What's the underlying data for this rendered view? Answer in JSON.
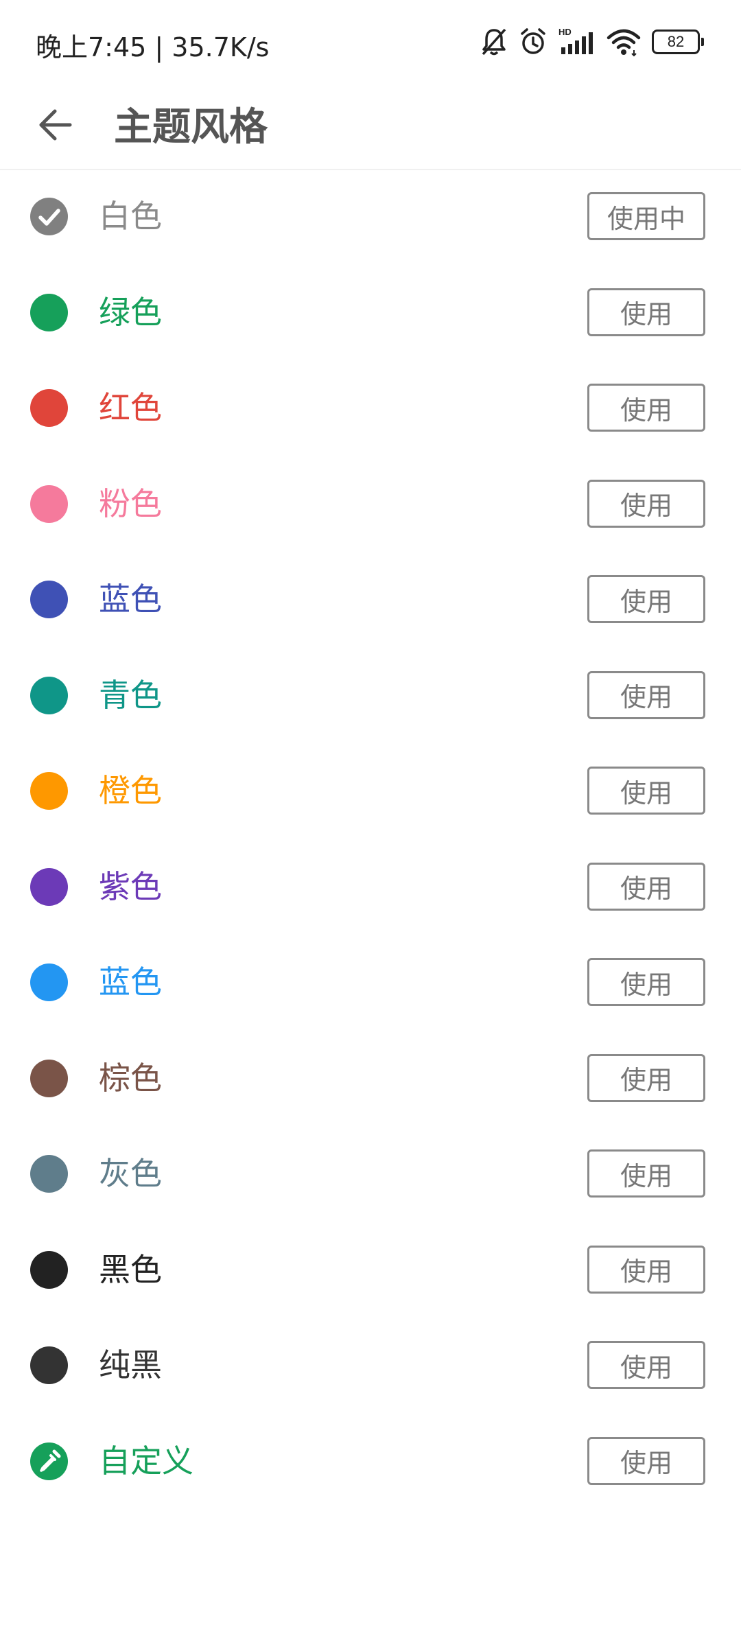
{
  "status_bar": {
    "time_speed": "晚上7:45 | 35.7K/s",
    "battery": "82",
    "icons": [
      "bell-muted-icon",
      "alarm-icon",
      "hd-signal-icon",
      "wifi-icon",
      "battery-icon"
    ]
  },
  "header": {
    "title": "主题风格",
    "back_icon": "arrow-left-icon"
  },
  "themes": [
    {
      "name": "白色",
      "color": "#808080",
      "text_color": "#8a8a8a",
      "button": "使用中",
      "selected": true
    },
    {
      "name": "绿色",
      "color": "#16a05a",
      "text_color": "#16a05a",
      "button": "使用"
    },
    {
      "name": "红色",
      "color": "#e0453a",
      "text_color": "#e0453a",
      "button": "使用"
    },
    {
      "name": "粉色",
      "color": "#f57a9c",
      "text_color": "#f57a9c",
      "button": "使用"
    },
    {
      "name": "蓝色",
      "color": "#3f51b5",
      "text_color": "#3f51b5",
      "button": "使用"
    },
    {
      "name": "青色",
      "color": "#0f9688",
      "text_color": "#0f9688",
      "button": "使用"
    },
    {
      "name": "橙色",
      "color": "#fe9800",
      "text_color": "#fe9800",
      "button": "使用"
    },
    {
      "name": "紫色",
      "color": "#6c3ab7",
      "text_color": "#6c3ab7",
      "button": "使用"
    },
    {
      "name": "蓝色",
      "color": "#2396f2",
      "text_color": "#2396f2",
      "button": "使用"
    },
    {
      "name": "棕色",
      "color": "#7a5448",
      "text_color": "#7a5448",
      "button": "使用"
    },
    {
      "name": "灰色",
      "color": "#5f7d8b",
      "text_color": "#5f7d8b",
      "button": "使用"
    },
    {
      "name": "黑色",
      "color": "#222222",
      "text_color": "#222222",
      "button": "使用"
    },
    {
      "name": "纯黑",
      "color": "#333333",
      "text_color": "#333333",
      "button": "使用"
    },
    {
      "name": "自定义",
      "color": "#16a05a",
      "text_color": "#16a05a",
      "button": "使用",
      "icon": "eyedropper-icon"
    }
  ]
}
